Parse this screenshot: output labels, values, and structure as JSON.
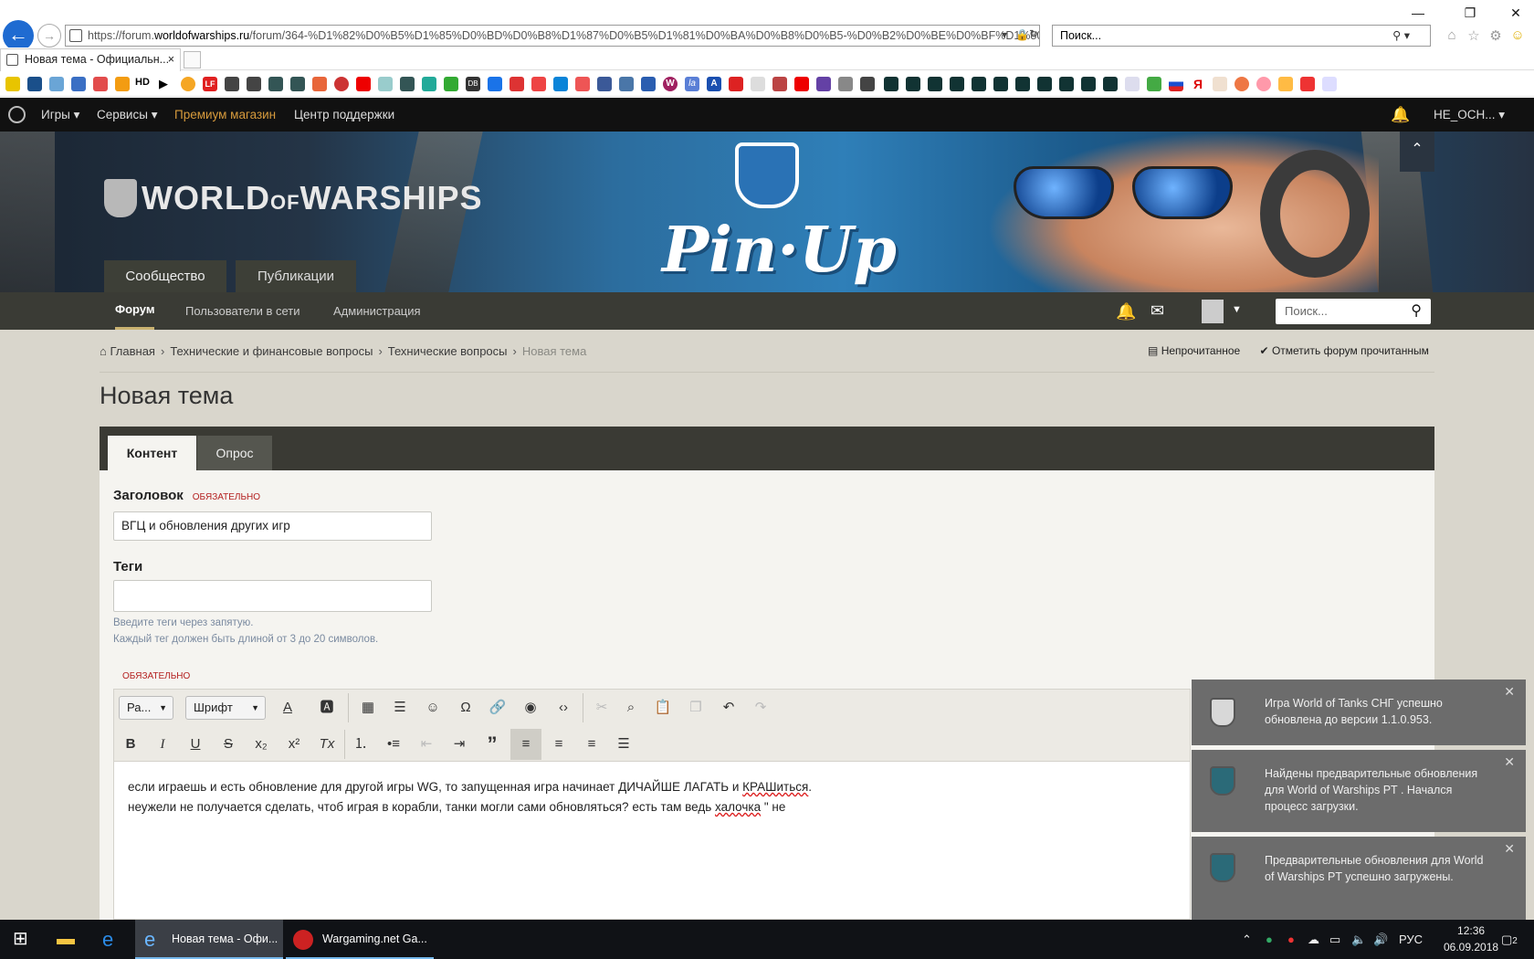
{
  "browser": {
    "url_prefix": "https://forum.",
    "url_domain": "worldofwarships.ru",
    "url_rest": "/forum/364-%D1%82%D0%B5%D1%85%D0%BD%D0%B8%D1%87%D0%B5%D1%81%D0%BA%D0%B8%D0%B5-%D0%B2%D0%BE%D0%BF%D1%80%D0%BE%D1%81%D1%8B/?do=add",
    "search_placeholder": "Поиск...",
    "tab_title": "Новая тема - Официальн...",
    "tab_close": "×",
    "new_tab_label": "",
    "favbar_hd": "HD",
    "favbar_brands": {
      "lf": "LF",
      "db": "DB",
      "w": "W",
      "la": "la",
      "a": "A",
      "ya": "Я"
    }
  },
  "site_topbar": {
    "games": "Игры",
    "services": "Сервисы",
    "premium": "Премиум магазин",
    "support": "Центр поддержки",
    "username": "НЕ_ОСН..."
  },
  "banner": {
    "logo_main": "WORLD",
    "logo_of": "OF",
    "logo_tail": "WARSHIPS",
    "event": "Pin·Up",
    "collapse": "⌃"
  },
  "main_tabs": {
    "community": "Сообщество",
    "publications": "Публикации"
  },
  "subnav": {
    "forum": "Форум",
    "online": "Пользователи в сети",
    "admin": "Администрация",
    "search_placeholder": "Поиск..."
  },
  "breadcrumb": {
    "home": "Главная",
    "c1": "Технические и финансовые вопросы",
    "c2": "Технические вопросы",
    "current": "Новая тема",
    "sep": "›"
  },
  "actions": {
    "unread": "Непрочитанное",
    "mark_read": "Отметить форум прочитанным"
  },
  "page": {
    "title": "Новая тема"
  },
  "form_tabs": {
    "content": "Контент",
    "poll": "Опрос"
  },
  "form": {
    "title_label": "Заголовок",
    "required": "ОБЯЗАТЕЛЬНО",
    "title_value": "ВГЦ и обновления других игр",
    "tags_label": "Теги",
    "tags_value": "",
    "hint1": "Введите теги через запятую.",
    "hint2": "Каждый тег должен быть длиной от 3 до 20 символов.",
    "body_required": "ОБЯЗАТЕЛЬНО"
  },
  "editor": {
    "size_dropdown": "Ра...",
    "font_dropdown": "Шрифт",
    "line1_a": "если играешь и есть обновление для другой игры WG, то запущенная игра начинает ДИЧАЙШЕ ЛАГАТЬ и ",
    "line1_b": "КРАШиться",
    "line1_c": ".",
    "line2_a": "неужели не получается сделать, чтоб играя в корабли, танки могли сами обновляться? есть там ведь ",
    "line2_b": "халочка",
    "line2_c": " \" не"
  },
  "toasts": [
    {
      "text": "Игра World of Tanks СНГ успешно обновлена до версии 1.1.0.953.",
      "close": "✕"
    },
    {
      "text": "Найдены предварительные обновления для World of Warships PT . Начался процесс загрузки.",
      "close": "✕"
    },
    {
      "text": "Предварительные обновления для World of Warships PT успешно загружены.",
      "close": "✕"
    }
  ],
  "taskbar": {
    "app1": "Новая тема - Офи...",
    "app2": "Wargaming.net Ga...",
    "lang": "РУС",
    "time": "12:36",
    "date": "06.09.2018",
    "notif_count": "2"
  }
}
